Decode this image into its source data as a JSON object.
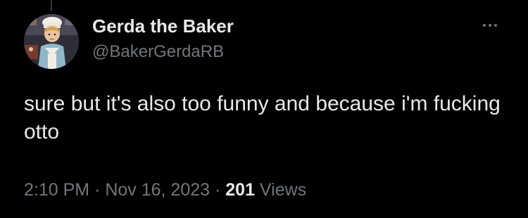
{
  "author": {
    "display_name": "Gerda the Baker",
    "handle": "@BakerGerdaRB"
  },
  "tweet": {
    "text": "sure but it's also too funny and because i'm fucking otto"
  },
  "meta": {
    "time": "2:10 PM",
    "separator_1": " · ",
    "date": "Nov 16, 2023",
    "separator_2": " · ",
    "views_count": "201",
    "views_label": " Views"
  },
  "icons": {
    "more": "more-horizontal-icon"
  },
  "colors": {
    "background": "#000000",
    "primary_text": "#e7e9ea",
    "secondary_text": "#71767b"
  }
}
